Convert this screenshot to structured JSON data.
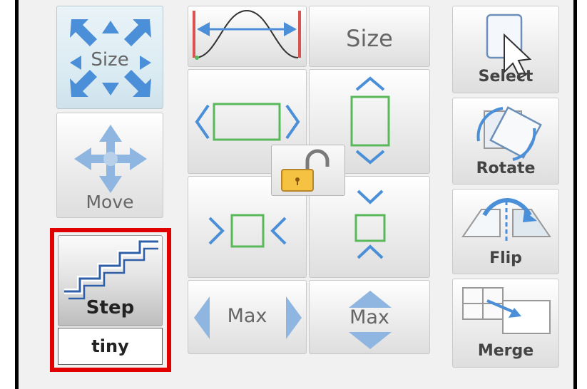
{
  "buttons": {
    "size_mode": "Size",
    "move": "Move",
    "step": "Step",
    "step_value": "tiny",
    "size": "Size",
    "max_width": "Max",
    "max_height": "Max",
    "select": "Select",
    "rotate": "Rotate",
    "flip": "Flip",
    "merge": "Merge"
  },
  "colors": {
    "highlight_border": "#e00000",
    "arrow_blue": "#4a8fd8",
    "rect_green": "#59b85a",
    "spread_marker_red": "#d9534f"
  }
}
